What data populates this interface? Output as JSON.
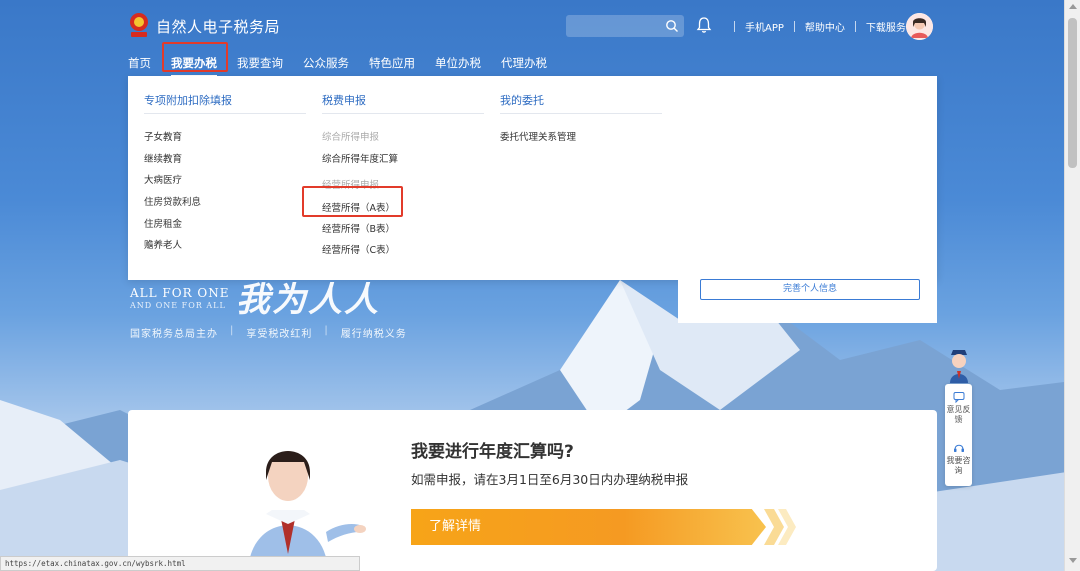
{
  "header": {
    "site_title": "自然人电子税务局",
    "search_placeholder": "",
    "links": [
      "手机APP",
      "帮助中心",
      "下载服务"
    ]
  },
  "nav": {
    "items": [
      "首页",
      "我要办税",
      "我要查询",
      "公众服务",
      "特色应用",
      "单位办税",
      "代理办税"
    ],
    "active_index": 1
  },
  "dropdown": {
    "col1": {
      "title": "专项附加扣除填报",
      "items": [
        "子女教育",
        "继续教育",
        "大病医疗",
        "住房贷款利息",
        "住房租金",
        "赡养老人"
      ]
    },
    "col2": {
      "title": "税费申报",
      "groups": [
        {
          "header": "综合所得申报",
          "items": [
            "综合所得年度汇算"
          ]
        },
        {
          "header": "经营所得申报",
          "items": [
            "经营所得（A表）",
            "经营所得（B表）",
            "经营所得（C表）"
          ]
        }
      ]
    },
    "col3": {
      "title": "我的委托",
      "items": [
        "委托代理关系管理"
      ]
    }
  },
  "hero": {
    "slogan_en1": "ALL FOR ONE",
    "slogan_en2": "AND ONE FOR ALL",
    "slogan_cn": "我为人人",
    "subline": [
      "国家税务总局主办",
      "享受税改红利",
      "履行纳税义务"
    ]
  },
  "profile": {
    "button": "完善个人信息"
  },
  "float_bar": {
    "feedback": "意见反馈",
    "consult": "我要咨询"
  },
  "banner": {
    "title": "我要进行年度汇算吗?",
    "subtitle": "如需申报，请在3月1日至6月30日内办理纳税申报",
    "button": "了解详情"
  },
  "status_url": "https://etax.chinatax.gov.cn/wybsrk.html",
  "colors": {
    "primary": "#2e6cc2",
    "highlight": "#e23b2a",
    "accent": "#f59a22"
  }
}
